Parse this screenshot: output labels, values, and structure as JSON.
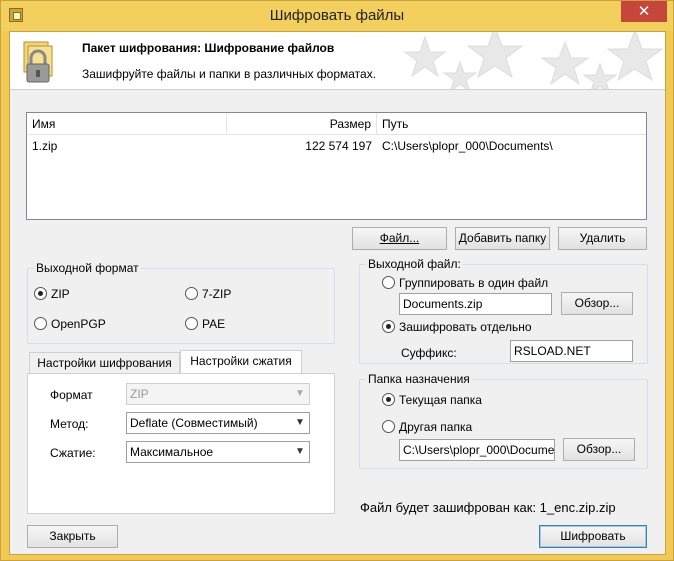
{
  "window": {
    "title": "Шифровать файлы",
    "close_label": "✕"
  },
  "header": {
    "title": "Пакет шифрования: Шифрование файлов",
    "subtitle": "Зашифруйте файлы и папки в различных форматах."
  },
  "file_list": {
    "columns": [
      "Имя",
      "Размер",
      "Путь"
    ],
    "rows": [
      {
        "name": "1.zip",
        "size": "122 574 197",
        "path": "C:\\Users\\plopr_000\\Documents\\"
      }
    ]
  },
  "list_buttons": {
    "file": "Файл...",
    "add_folder": "Добавить папку",
    "delete": "Удалить"
  },
  "output_format": {
    "title": "Выходной формат",
    "options": [
      "ZIP",
      "7-ZIP",
      "OpenPGP",
      "PAE"
    ],
    "selected": "ZIP"
  },
  "tabs": {
    "items": [
      "Настройки шифрования",
      "Настройки сжатия"
    ],
    "active": "Настройки сжатия"
  },
  "compression": {
    "format_label": "Формат",
    "format_value": "ZIP",
    "method_label": "Метод:",
    "method_value": "Deflate (Совместимый)",
    "level_label": "Сжатие:",
    "level_value": "Максимальное"
  },
  "output_file": {
    "title": "Выходной файл:",
    "group_label": "Группировать в один файл",
    "group_value": "Documents.zip",
    "browse_label": "Обзор...",
    "separate_label": "Зашифровать отдельно",
    "suffix_label": "Суффикс:",
    "suffix_value": "RSLOAD.NET",
    "selected": "separate"
  },
  "destination": {
    "title": "Папка назначения",
    "current_label": "Текущая папка",
    "other_label": "Другая папка",
    "other_value": "C:\\Users\\plopr_000\\Documer",
    "browse_label": "Обзор...",
    "selected": "current"
  },
  "result_text": "Файл будет зашифрован как: 1_enc.zip.zip",
  "footer": {
    "close_label": "Закрыть",
    "encrypt_label": "Шифровать"
  }
}
